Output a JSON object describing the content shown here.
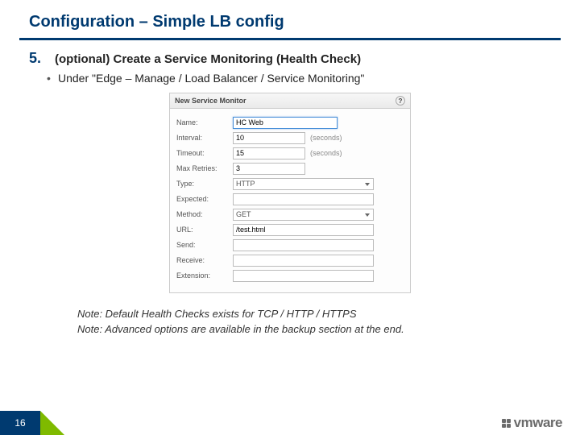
{
  "slide": {
    "title": "Configuration – Simple LB config",
    "pageNumber": "16"
  },
  "step": {
    "number": "5.",
    "text": "(optional) Create a Service Monitoring (Health Check)"
  },
  "bullet": "Under \"Edge – Manage /  Load Balancer / Service Monitoring\"",
  "dialog": {
    "title": "New Service Monitor",
    "helpGlyph": "?",
    "labels": {
      "name": "Name:",
      "interval": "Interval:",
      "timeout": "Timeout:",
      "maxRetries": "Max Retries:",
      "type": "Type:",
      "expected": "Expected:",
      "method": "Method:",
      "url": "URL:",
      "send": "Send:",
      "receive": "Receive:",
      "extension": "Extension:"
    },
    "values": {
      "name": "HC Web",
      "interval": "10",
      "timeout": "15",
      "maxRetries": "3",
      "type": "HTTP",
      "expected": "",
      "method": "GET",
      "url": "/test.html",
      "send": "",
      "receive": "",
      "extension": ""
    },
    "units": {
      "seconds": "(seconds)"
    }
  },
  "notes": {
    "n1": "Note: Default Health Checks exists for TCP / HTTP / HTTPS",
    "n2": "Note: Advanced options are available in the backup section at the end."
  },
  "brand": "vmware"
}
